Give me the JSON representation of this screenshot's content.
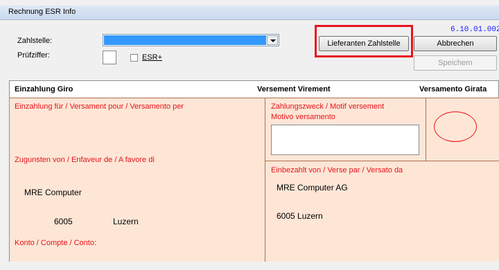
{
  "window": {
    "title": "Rechnung ESR Info"
  },
  "form": {
    "zahlstelle_label": "Zahlstelle:",
    "pruefziffer_label": "Prüfziffer:",
    "esr_label": "ESR+",
    "esr_checked": false,
    "zahlstelle_value": ""
  },
  "buttons": {
    "lieferanten": "Lieferanten Zahlstelle",
    "abbrechen": "Abbrechen",
    "speichern": "Speichern"
  },
  "version": "6.10.01.002",
  "slip": {
    "header_left": "Einzahlung Giro",
    "header_mid": "Versement Virement",
    "header_right": "Versamento Girata",
    "einzahlung_fuer": "Einzahlung für / Versament pour / Versamento per",
    "zahlungszweck_line1": "Zahlungszweck / Motif versement",
    "zahlungszweck_line2": "Motivo versamento",
    "zugunsten": "Zugunsten von / Enfaveur de / A favore di",
    "einbezahlt": "Einbezahlt von / Verse par / Versato da",
    "recipient_name": "MRE Computer",
    "recipient_zip": "6005",
    "recipient_city": "Luzern",
    "payer_name": "MRE Computer AG",
    "payer_address": "6005 Luzern",
    "konto": "Konto / Compte / Conto:"
  },
  "colors": {
    "accent_red": "#e8121b",
    "slip_background": "#fde6d6",
    "selection_blue": "#3399ff",
    "version_blue": "#1a1aff"
  }
}
